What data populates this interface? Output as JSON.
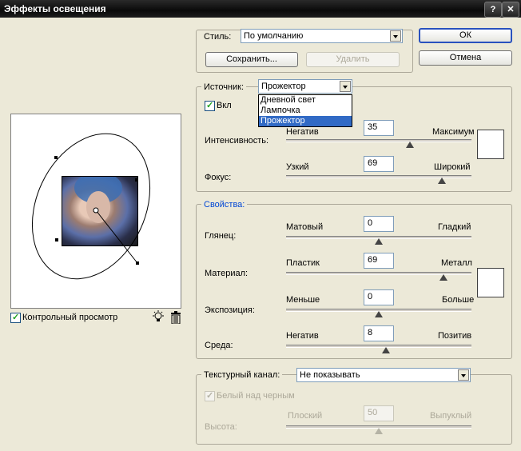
{
  "window": {
    "title": "Эффекты освещения",
    "help_glyph": "?",
    "close_glyph": "✕"
  },
  "style": {
    "label": "Стиль:",
    "value": "По умолчанию",
    "save_label": "Сохранить...",
    "delete_label": "Удалить"
  },
  "buttons": {
    "ok": "ОК",
    "cancel": "Отмена"
  },
  "source": {
    "label": "Источник:",
    "value": "Прожектор",
    "options": [
      "Дневной свет",
      "Лампочка",
      "Прожектор"
    ],
    "selected_index": 2,
    "on_label": "Вкл",
    "intensity": {
      "label": "Интенсивность:",
      "min_label": "Негатив",
      "max_label": "Максимум",
      "value": "35",
      "fraction": 0.67
    },
    "focus": {
      "label": "Фокус:",
      "min_label": "Узкий",
      "max_label": "Широкий",
      "value": "69",
      "fraction": 0.84
    }
  },
  "properties": {
    "title": "Свойства:",
    "gloss": {
      "label": "Глянец:",
      "min_label": "Матовый",
      "max_label": "Гладкий",
      "value": "0",
      "fraction": 0.5
    },
    "material": {
      "label": "Материал:",
      "min_label": "Пластик",
      "max_label": "Металл",
      "value": "69",
      "fraction": 0.85
    },
    "exposure": {
      "label": "Экспозиция:",
      "min_label": "Меньше",
      "max_label": "Больше",
      "value": "0",
      "fraction": 0.5
    },
    "ambience": {
      "label": "Среда:",
      "min_label": "Негатив",
      "max_label": "Позитив",
      "value": "8",
      "fraction": 0.54
    }
  },
  "texture": {
    "label": "Текстурный канал:",
    "value": "Не показывать",
    "white_high_label": "Белый над черным",
    "height": {
      "label": "Высота:",
      "min_label": "Плоский",
      "max_label": "Выпуклый",
      "value": "50",
      "fraction": 0.5
    }
  },
  "preview": {
    "checkbox_label": "Контрольный просмотр",
    "light_icon": "lightbulb-icon",
    "trash_icon": "trash-icon"
  },
  "colors": {
    "accent": "#0046d5",
    "selection": "#316ac5"
  }
}
